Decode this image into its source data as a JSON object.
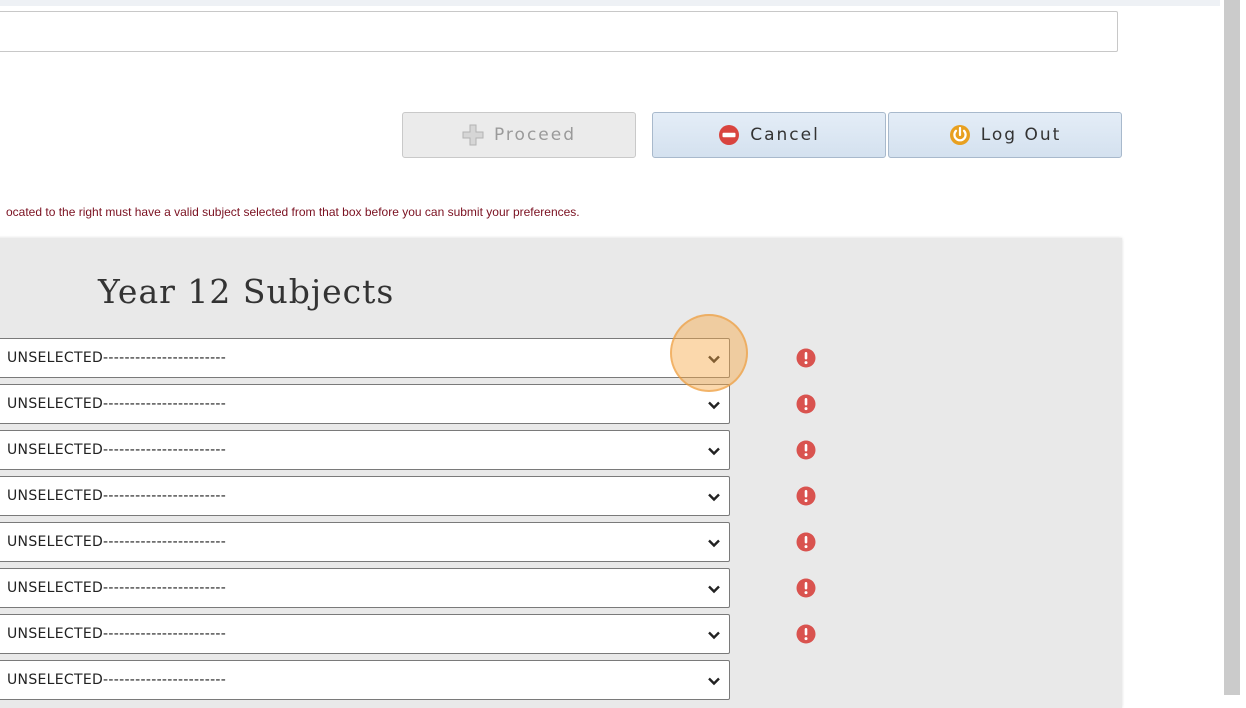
{
  "toolbar": {
    "proceed_label": "Proceed",
    "cancel_label": "Cancel",
    "logout_label": "Log Out"
  },
  "text_field": {
    "value": ""
  },
  "warning": "ocated to the right must have a valid subject selected from that box before you can submit your preferences.",
  "subjects": {
    "title": "Year 12 Subjects",
    "selects": [
      {
        "value": "UNSELECTED-----------------------",
        "has_error": true
      },
      {
        "value": "UNSELECTED-----------------------",
        "has_error": true
      },
      {
        "value": "UNSELECTED-----------------------",
        "has_error": true
      },
      {
        "value": "UNSELECTED-----------------------",
        "has_error": true
      },
      {
        "value": "UNSELECTED-----------------------",
        "has_error": true
      },
      {
        "value": "UNSELECTED-----------------------",
        "has_error": true
      },
      {
        "value": "UNSELECTED-----------------------",
        "has_error": true
      },
      {
        "value": "UNSELECTED-----------------------",
        "has_error": false
      }
    ]
  },
  "icons": {
    "proceed": "plus-icon",
    "cancel": "stop-icon",
    "logout": "power-icon",
    "error": "error-icon",
    "dropdown": "chevron-down-icon"
  },
  "colors": {
    "error_red": "#d9534f",
    "warning_text": "#7a1020",
    "logout_icon": "#e8a020",
    "highlight": "#f7a846"
  }
}
